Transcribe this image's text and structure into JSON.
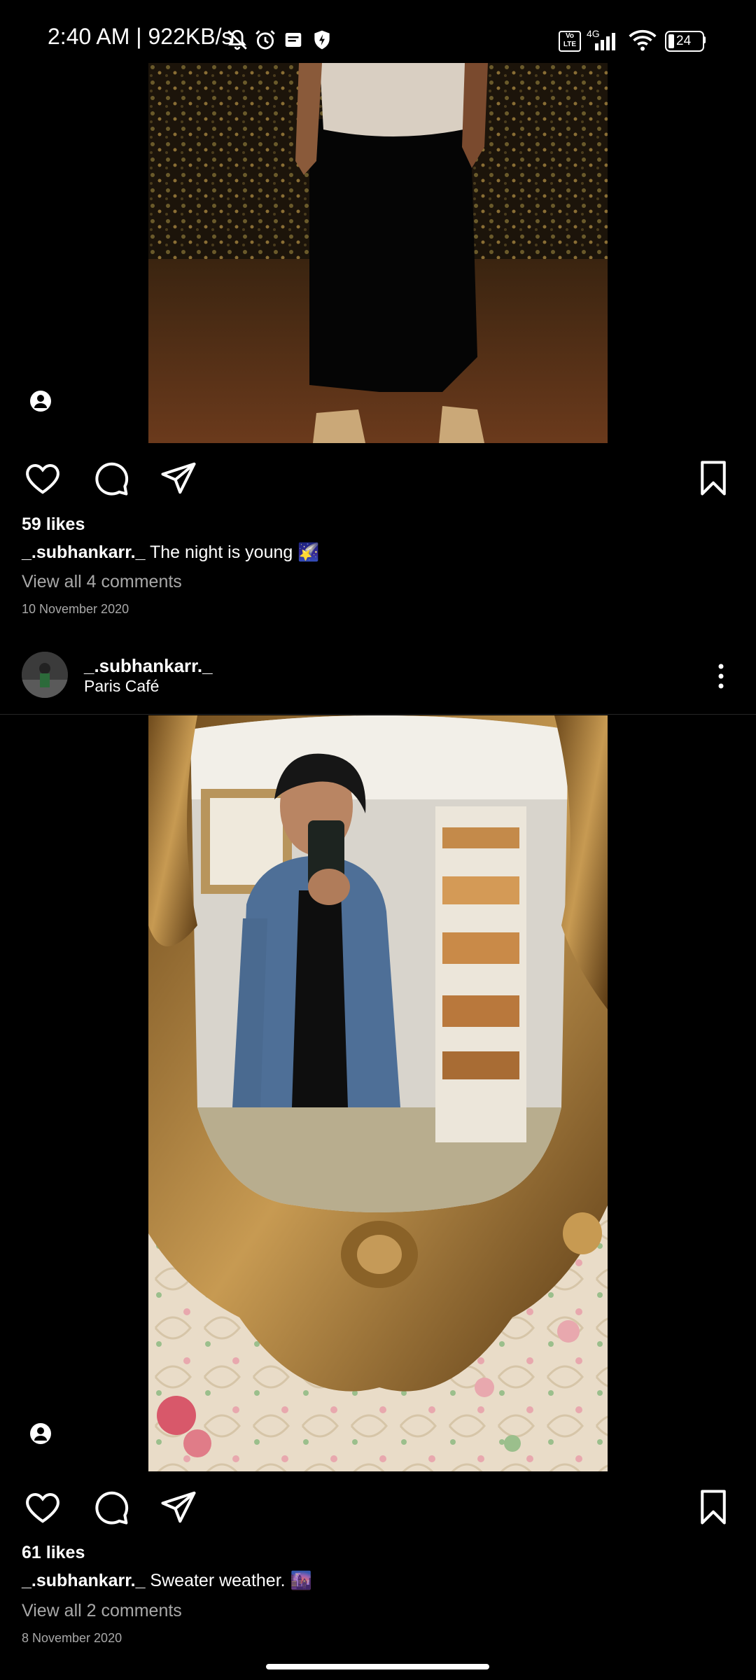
{
  "status_bar": {
    "time": "2:40 AM | 922KB/s",
    "network_label": "4G",
    "volte_label": "Vo LTE",
    "battery": "24"
  },
  "posts": [
    {
      "likes": "59 likes",
      "username": "_.subhankarr._",
      "caption": " The night is young 🌠",
      "view_comments": "View all 4 comments",
      "date": "10 November 2020"
    },
    {
      "username": "_.subhankarr._",
      "location": "Paris Café",
      "likes": "61 likes",
      "caption": " Sweater weather. 🌆",
      "view_comments": "View all 2 comments",
      "date": "8 November 2020"
    }
  ],
  "icons": {
    "like": "heart-icon",
    "comment": "comment-icon",
    "share": "send-icon",
    "save": "bookmark-icon",
    "tag": "user-tag-icon",
    "more": "more-vertical-icon"
  },
  "colors": {
    "background": "#000000",
    "text": "#ffffff",
    "secondary_text": "#a8a8a8",
    "divider": "#262626"
  }
}
